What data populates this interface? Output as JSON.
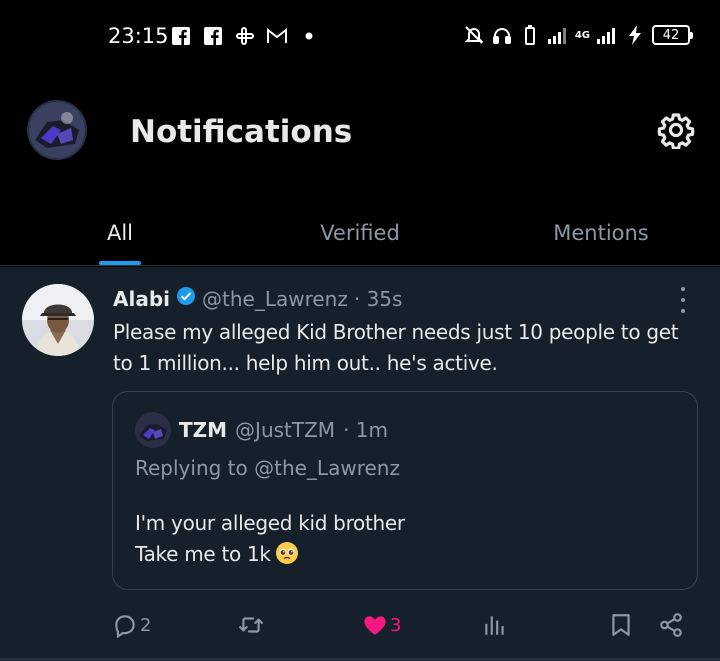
{
  "status_bar": {
    "time": "23:15",
    "network": "4G",
    "battery": "42"
  },
  "header": {
    "title": "Notifications"
  },
  "tabs": [
    {
      "label": "All",
      "active": true
    },
    {
      "label": "Verified",
      "active": false
    },
    {
      "label": "Mentions",
      "active": false
    }
  ],
  "tweet": {
    "author": "Alabi",
    "handle": "@the_Lawrenz",
    "time": "· 35s",
    "text": "Please my alleged Kid Brother needs just 10 people to get to 1 million... help him out.. he's active.",
    "quote": {
      "author": "TZM",
      "handle": "@JustTZM",
      "time": "· 1m",
      "replying_to": "Replying to @the_Lawrenz",
      "line1": "I'm your alleged kid brother",
      "line2": "Take me to 1k"
    },
    "actions": {
      "replies": "2",
      "likes": "3"
    }
  },
  "colors": {
    "accent": "#1d9bf0",
    "like": "#f91880",
    "background": "#15202b",
    "muted": "#8b98a5"
  }
}
